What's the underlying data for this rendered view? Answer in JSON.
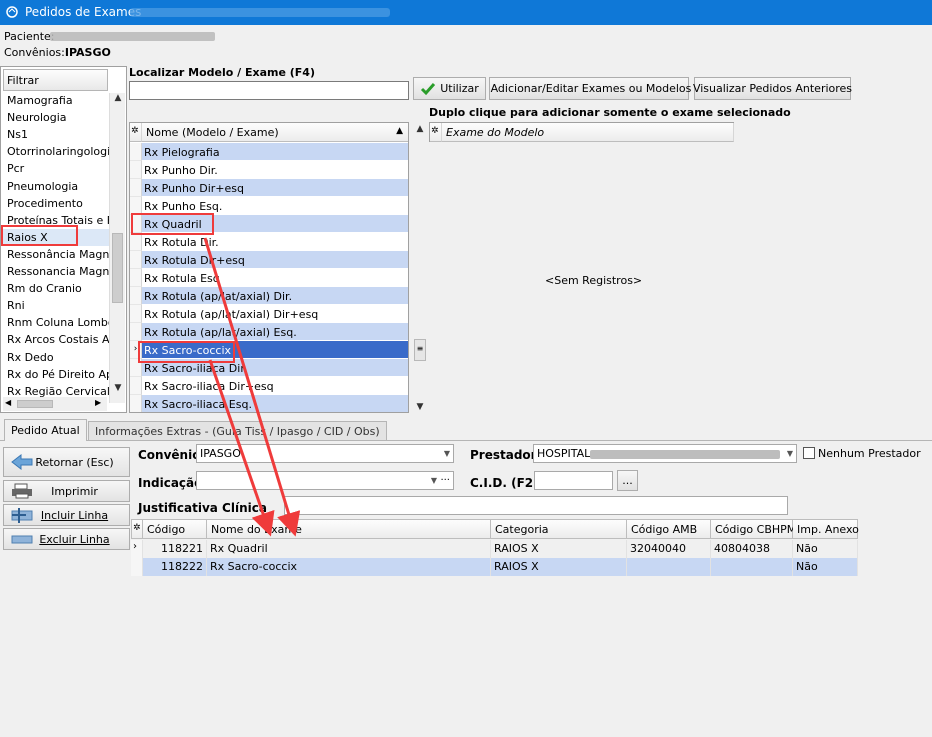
{
  "window": {
    "title": "Pedidos de Exames"
  },
  "patient": {
    "label": "Paciente:",
    "insurance_label": "Convênios:",
    "insurance_value": "IPASGO"
  },
  "filter": {
    "header": "Filtrar",
    "items": [
      "Mamografia",
      "Neurologia",
      "Ns1",
      "Otorrinolaringologia",
      "Pcr",
      "Pneumologia",
      "Procedimento",
      "Proteínas Totais e Fr",
      "Raios X",
      "Ressonância Magnéti",
      "Ressonancia Magneti",
      "Rm do Cranio",
      "Rni",
      "Rnm Coluna Lombo-s",
      "Rx Arcos Costais Ap,",
      "Rx Dedo",
      "Rx do Pé Direito Ap,",
      "Rx Região Cervical A"
    ]
  },
  "search": {
    "label": "Localizar Modelo / Exame (F4)",
    "value": "",
    "use_button": "Utilizar",
    "add_edit_button": "Adicionar/Editar Exames ou Modelos",
    "view_previous_button": "Visualizar Pedidos Anteriores"
  },
  "models_grid": {
    "column": "Nome (Modelo / Exame)",
    "rows": [
      "Rx Pielografia",
      "Rx Punho Dir.",
      "Rx Punho Dir+esq",
      "Rx Punho Esq.",
      "Rx Quadril",
      "Rx Rotula  Dir.",
      "Rx Rotula  Dir+esq",
      "Rx Rotula  Esq",
      "Rx Rotula (ap/lat/axial) Dir.",
      "Rx Rotula (ap/lat/axial) Dir+esq",
      "Rx Rotula (ap/lat/axial) Esq.",
      "Rx Sacro-coccix",
      "Rx Sacro-iliaca Dir.",
      "Rx Sacro-iliaca Dir+esq",
      "Rx Sacro-iliaca Esq."
    ],
    "selected_index": 11
  },
  "exam_grid": {
    "hint": "Duplo clique para adicionar somente o exame selecionado",
    "column": "Exame do Modelo",
    "empty_text": "<Sem Registros>"
  },
  "tabs": [
    "Pedido Atual",
    "Informações Extras -  (Guia Tiss / Ipasgo / CID / Obs)"
  ],
  "actions": {
    "return": "Retornar (Esc)",
    "print": "Imprimir",
    "add_line": "Incluir Linha",
    "delete_line": "Excluir Linha"
  },
  "form": {
    "insurance_label": "Convênio",
    "insurance_value": "IPASGO",
    "provider_label": "Prestador",
    "provider_value": "HOSPITAL",
    "no_provider_label": "Nenhum Prestador",
    "indication_label": "Indicação",
    "indication_value": "",
    "cid_label": "C.I.D. (F2)",
    "cid_value": "",
    "ellipsis": "...",
    "justification_label": "Justificativa Clínica",
    "justification_value": ""
  },
  "orders": {
    "columns": [
      "Código",
      "Nome do Exame",
      "Categoria",
      "Código AMB",
      "Código CBHPM",
      "Imp. Anexo"
    ],
    "rows": [
      [
        "118221",
        "Rx Quadril",
        "RAIOS X",
        "32040040",
        "40804038",
        "Não"
      ],
      [
        "118222",
        "Rx Sacro-coccix",
        "RAIOS X",
        "",
        "",
        "Não"
      ]
    ]
  },
  "colors": {
    "titlebar": "#0f78d7",
    "row_alt": "#c7d7f3",
    "row_selected": "#3a6bc9",
    "highlight": "#ef3b3b"
  }
}
